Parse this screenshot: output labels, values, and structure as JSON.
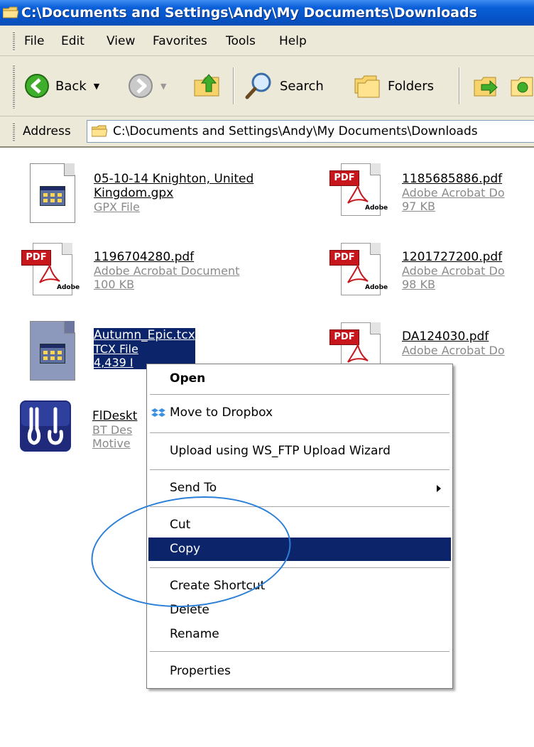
{
  "window": {
    "title": "C:\\Documents and Settings\\Andy\\My Documents\\Downloads"
  },
  "menubar": [
    "File",
    "Edit",
    "View",
    "Favorites",
    "Tools",
    "Help"
  ],
  "toolbar": {
    "back": "Back",
    "search": "Search",
    "folders": "Folders"
  },
  "address": {
    "label": "Address",
    "value": "C:\\Documents and Settings\\Andy\\My Documents\\Downloads"
  },
  "files": [
    {
      "name1": "05-10-14 Knighton, United",
      "name2": "Kingdom.gpx",
      "type": "GPX File",
      "size": ""
    },
    {
      "name1": "1185685886.pdf",
      "type": "Adobe Acrobat Do",
      "size": "97 KB"
    },
    {
      "name1": "1196704280.pdf",
      "type": "Adobe Acrobat Document",
      "size": "100 KB"
    },
    {
      "name1": "1201727200.pdf",
      "type": "Adobe Acrobat Do",
      "size": "98 KB"
    },
    {
      "name1": "Autumn_Epic.tcx",
      "type": "TCX File",
      "size": "4,439 I"
    },
    {
      "name1": "DA124030.pdf",
      "type": "Adobe Acrobat Do",
      "size": ""
    },
    {
      "name1": "FlDeskt",
      "type": "BT Des",
      "size": "Motive"
    }
  ],
  "icon_labels": {
    "pdf_banner": "PDF",
    "adobe": "Adobe"
  },
  "context_menu": {
    "open": "Open",
    "dropbox": "Move to Dropbox",
    "upload": "Upload using WS_FTP Upload Wizard",
    "send_to": "Send To",
    "cut": "Cut",
    "copy": "Copy",
    "shortcut": "Create Shortcut",
    "delete": "Delete",
    "rename": "Rename",
    "properties": "Properties"
  },
  "colors": {
    "selection": "#0b246a",
    "annotation_ellipse": "#2b7fd8",
    "pdf_red": "#c8161d"
  }
}
